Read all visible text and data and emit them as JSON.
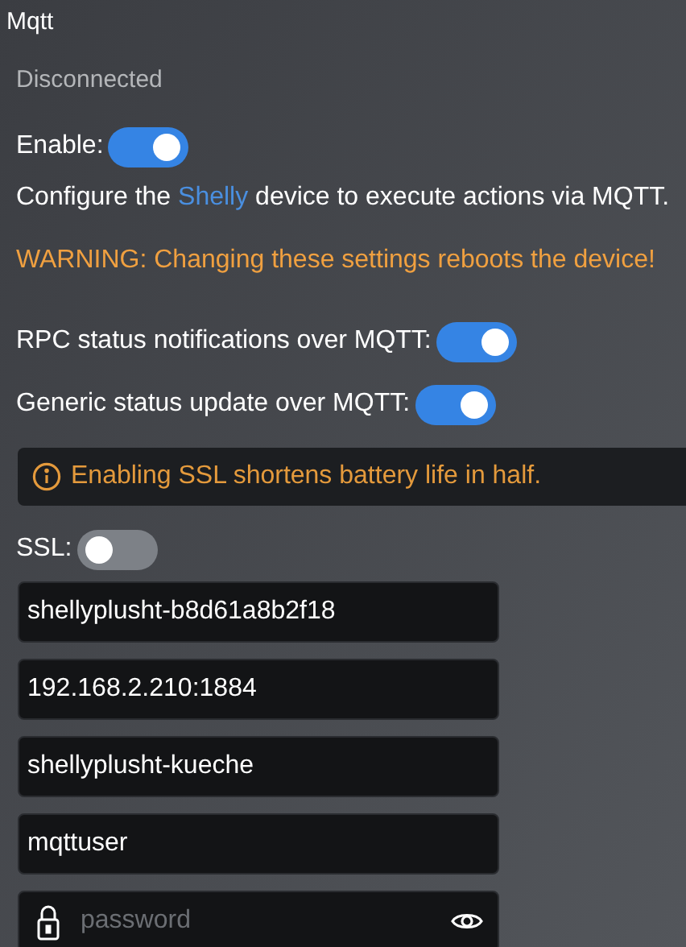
{
  "title": "Mqtt",
  "status": "Disconnected",
  "enable": {
    "label": "Enable:",
    "on": true
  },
  "description": {
    "before": "Configure the ",
    "link": "Shelly",
    "after": " device to execute actions via MQTT."
  },
  "warning": "WARNING: Changing these settings reboots the device!",
  "options": [
    {
      "label": "RPC status notifications over MQTT:",
      "on": true
    },
    {
      "label": "Generic status update over MQTT:",
      "on": true
    }
  ],
  "info": "Enabling SSL shortens battery life in half.",
  "ssl": {
    "label": "SSL:",
    "on": false
  },
  "fields": [
    {
      "value": "shellyplusht-b8d61a8b2f18"
    },
    {
      "value": "192.168.2.210:1884"
    },
    {
      "value": "shellyplusht-kueche"
    },
    {
      "value": "mqttuser"
    },
    {
      "kind": "password",
      "placeholder": "password"
    }
  ]
}
